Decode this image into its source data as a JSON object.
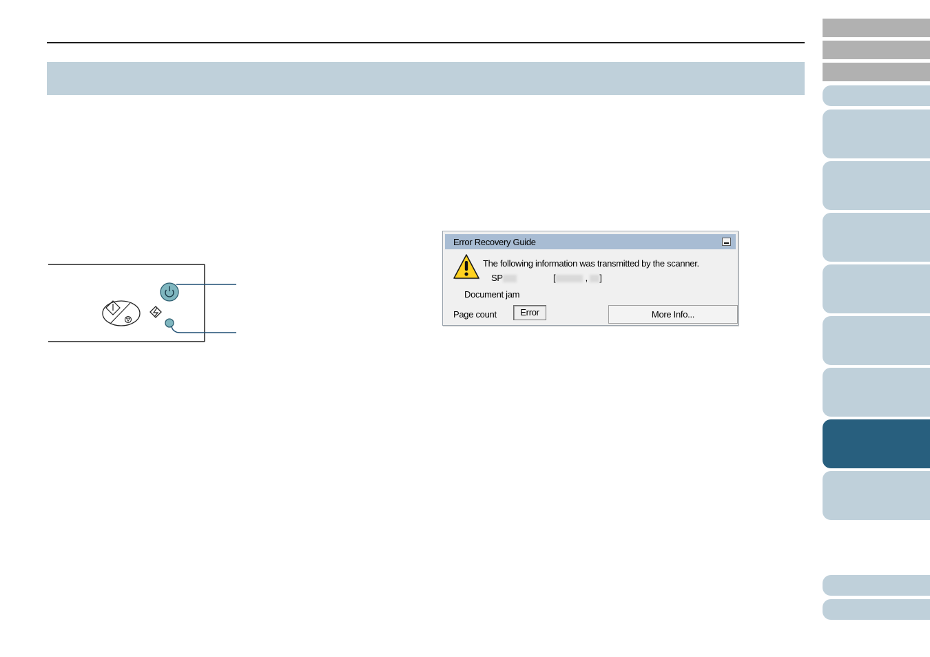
{
  "dialog": {
    "title": "Error Recovery Guide",
    "message": "The following information was transmitted by the scanner.",
    "model_prefix": "SP",
    "code_open_bracket": "[",
    "code_separator": ",",
    "code_close_bracket": "]",
    "status": "Document jam",
    "page_count_label": "Page count",
    "error_button_label": "Error",
    "more_info_button_label": "More Info..."
  },
  "icons": {
    "power": "power-icon",
    "start_stop": "scan-stop-icon",
    "function": "function-icon",
    "warning": "warning-icon",
    "minimize": "minimize-icon"
  },
  "colors": {
    "section_band": "#bfd0da",
    "nav_tab": "#bfd0da",
    "nav_tab_active": "#285f7e",
    "nav_tab_gray": "#b1b1b1",
    "led": "#7fb6bf",
    "callout_line": "#1f4f73",
    "dialog_titlebar": "#a8bcd3"
  }
}
